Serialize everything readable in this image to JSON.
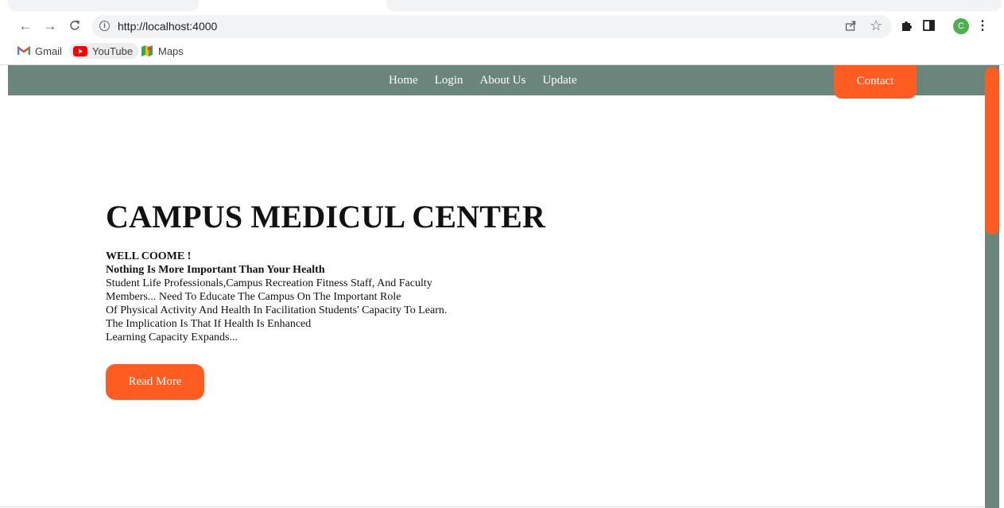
{
  "browser": {
    "url": "http://localhost:4000",
    "bookmarks": [
      {
        "label": "Gmail",
        "icon": "gmail-icon"
      },
      {
        "label": "YouTube",
        "icon": "youtube-icon"
      },
      {
        "label": "Maps",
        "icon": "maps-icon"
      }
    ],
    "profile_initial": "C",
    "icons": {
      "back": "arrow-left-icon",
      "forward": "arrow-right-icon",
      "reload": "reload-icon",
      "info": "info-icon",
      "share": "share-icon",
      "bookmark": "star-icon",
      "extensions": "puzzle-icon",
      "side_panel": "side-panel-icon",
      "menu": "kebab-menu-icon"
    }
  },
  "site": {
    "nav": [
      "Home",
      "Login",
      "About Us",
      "Update"
    ],
    "contact_label": "Contact",
    "title": "CAMPUS MEDICUL CENTER",
    "welcome": "WELL COOME !",
    "tagline": "Nothing Is More Important Than Your Health",
    "body_lines": [
      "Student Life Professionals,Campus Recreation Fitness Staff, And Faculty",
      "Members... Need To Educate The Campus On The Important Role",
      "Of Physical Activity And Health In Facilitation Students' Capacity To Learn.",
      "The Implication Is That If Health Is Enhanced",
      "Learning Capacity Expands..."
    ],
    "read_more_label": "Read More"
  },
  "colors": {
    "header": "#6a857c",
    "accent": "#ff5c21",
    "text": "#111111"
  }
}
